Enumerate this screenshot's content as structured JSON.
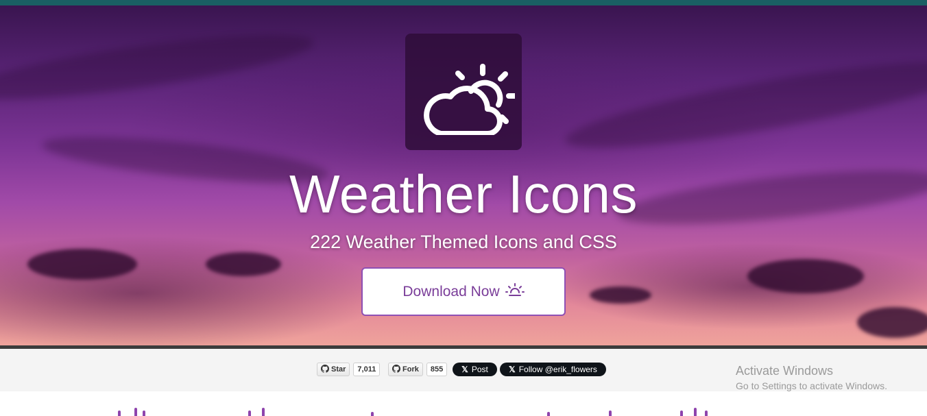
{
  "hero": {
    "title": "Weather Icons",
    "subtitle": "222 Weather Themed Icons and CSS",
    "download_label": "Download Now",
    "logo_icon": "day-cloudy-icon",
    "download_icon": "sunrise-icon"
  },
  "social": {
    "star_label": "Star",
    "star_count": "7,011",
    "fork_label": "Fork",
    "fork_count": "855",
    "post_label": "Post",
    "follow_label": "Follow @erik_flowers"
  },
  "watermark": {
    "line1": "Activate Windows",
    "line2": "Go to Settings to activate Windows."
  },
  "colors": {
    "accent": "#8e44ad",
    "topbar": "#1a5f63",
    "x_button": "#0f1419"
  }
}
